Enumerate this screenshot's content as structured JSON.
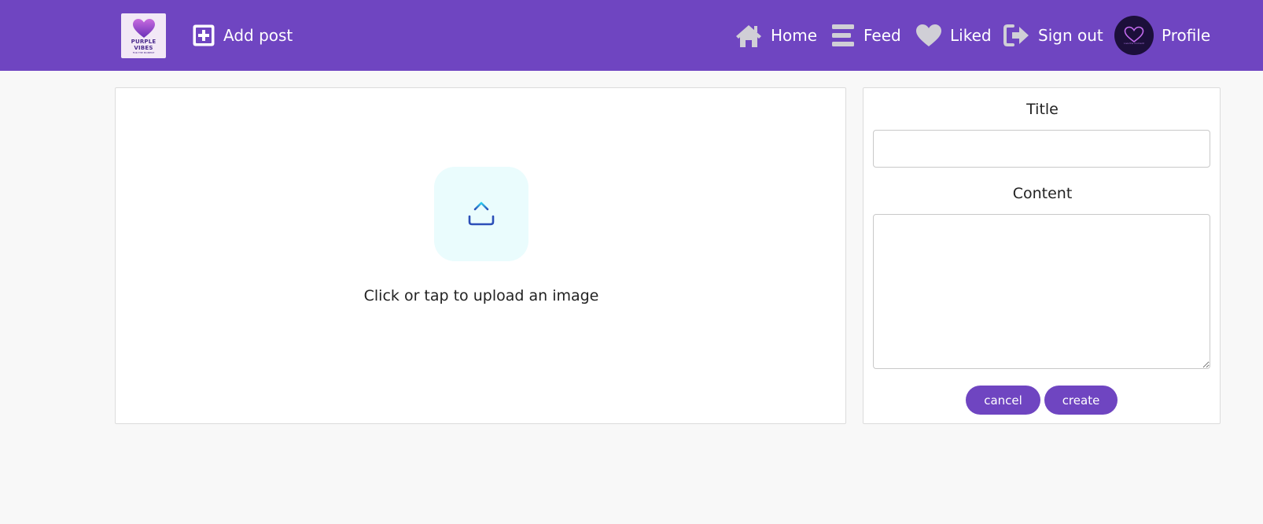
{
  "navbar": {
    "logo": {
      "text_line1": "PURPLE",
      "text_line2": "VIBES",
      "tagline": "FOR THE MOMENT",
      "icon": "heart-logo"
    },
    "add_post": {
      "label": "Add post",
      "icon": "plus-square-icon"
    },
    "home": {
      "label": "Home",
      "icon": "home-icon"
    },
    "feed": {
      "label": "Feed",
      "icon": "bars-icon"
    },
    "liked": {
      "label": "Liked",
      "icon": "heart-icon"
    },
    "sign_out": {
      "label": "Sign out",
      "icon": "sign-out-icon"
    },
    "profile": {
      "label": "Profile",
      "avatar_tagline": "Live the moment"
    }
  },
  "upload": {
    "icon": "upload-icon",
    "prompt": "Click or tap to upload an image"
  },
  "form": {
    "title_label": "Title",
    "title_value": "",
    "content_label": "Content",
    "content_value": "",
    "cancel_label": "cancel",
    "create_label": "create"
  },
  "colors": {
    "brand": "#6f45c1",
    "background": "#f8f8f8",
    "icon_gray": "#d0cfd6",
    "upload_tile": "#eafcfd"
  }
}
